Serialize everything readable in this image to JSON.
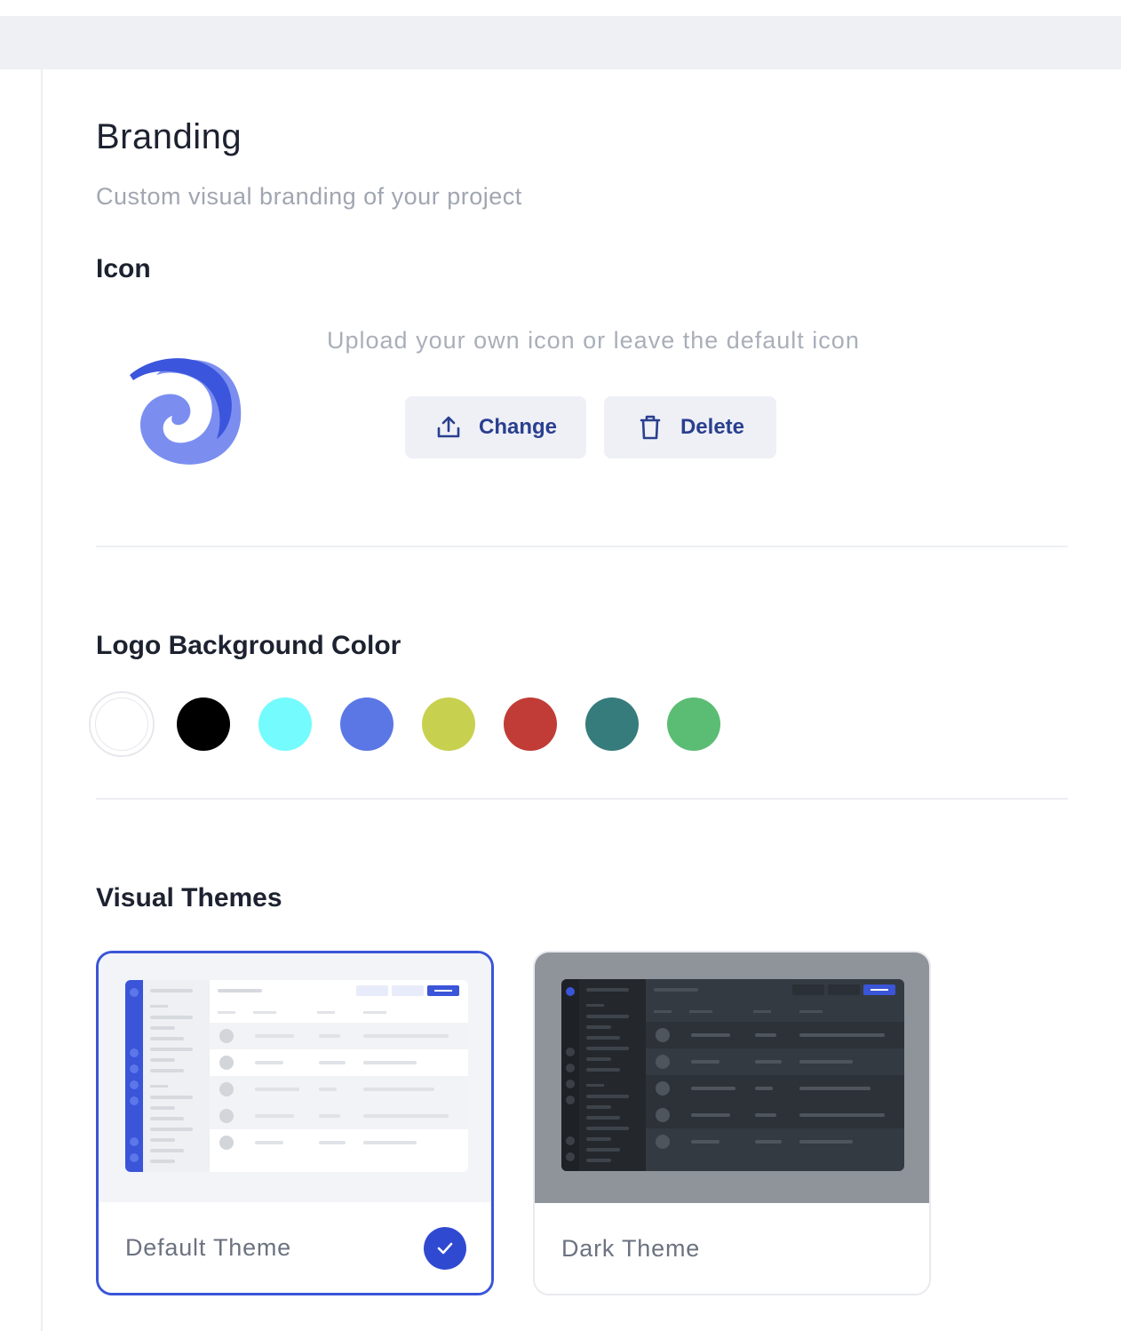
{
  "header": {
    "title": "Branding",
    "subtitle": "Custom visual branding of your project"
  },
  "icon_section": {
    "heading": "Icon",
    "hint": "Upload your own icon or leave the default icon",
    "change_label": "Change",
    "delete_label": "Delete",
    "change_icon": "upload-icon",
    "delete_icon": "trash-icon"
  },
  "logo_color_section": {
    "heading": "Logo Background Color",
    "colors": [
      "#ffffff",
      "#000000",
      "#74fbfd",
      "#5b77e6",
      "#c8d050",
      "#c13c36",
      "#377c7c",
      "#5bbd74"
    ],
    "selected": "#ffffff"
  },
  "themes_section": {
    "heading": "Visual Themes",
    "themes": [
      {
        "name": "Default Theme",
        "selected": true
      },
      {
        "name": "Dark Theme",
        "selected": false
      }
    ]
  },
  "colors": {
    "accent": "#3049d1",
    "button_text": "#2a3f8f"
  }
}
